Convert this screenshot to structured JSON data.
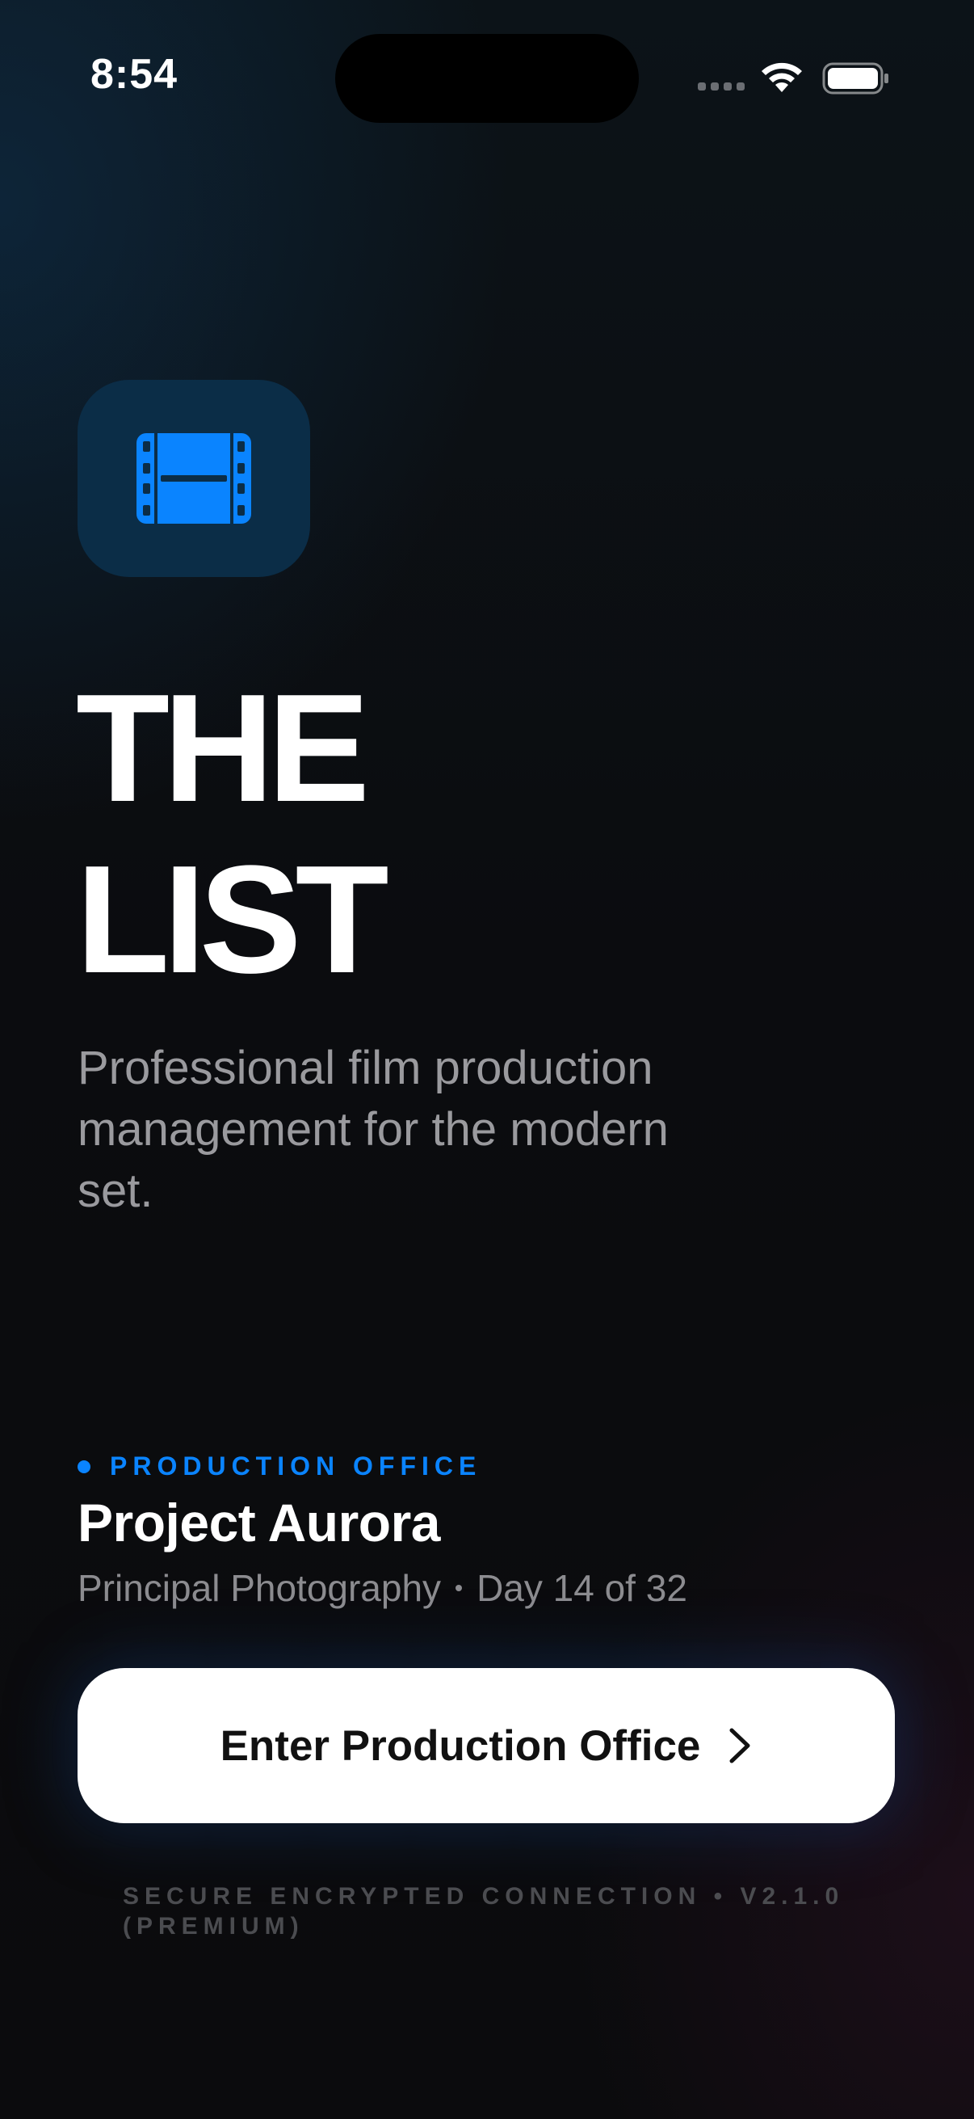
{
  "status_bar": {
    "time": "8:54",
    "icons": [
      "cellular-signal-icon",
      "wifi-icon",
      "battery-icon"
    ]
  },
  "app_icon": {
    "icon": "film-icon",
    "accent_color": "#0a84ff"
  },
  "hero": {
    "title_line1": "THE",
    "title_line2": "LIST",
    "subtitle": "Professional film production management for the modern set."
  },
  "production": {
    "tag_label": "PRODUCTION OFFICE",
    "project_name": "Project Aurora",
    "phase": "Principal Photography",
    "day_progress": "Day 14 of 32"
  },
  "cta": {
    "label": "Enter Production Office",
    "icon": "chevron-right-icon"
  },
  "footer": {
    "text": "SECURE ENCRYPTED CONNECTION • V2.1.0 (PREMIUM)"
  },
  "colors": {
    "accent": "#0a84ff",
    "background": "#0b0c0e",
    "button": "#ffffff"
  }
}
